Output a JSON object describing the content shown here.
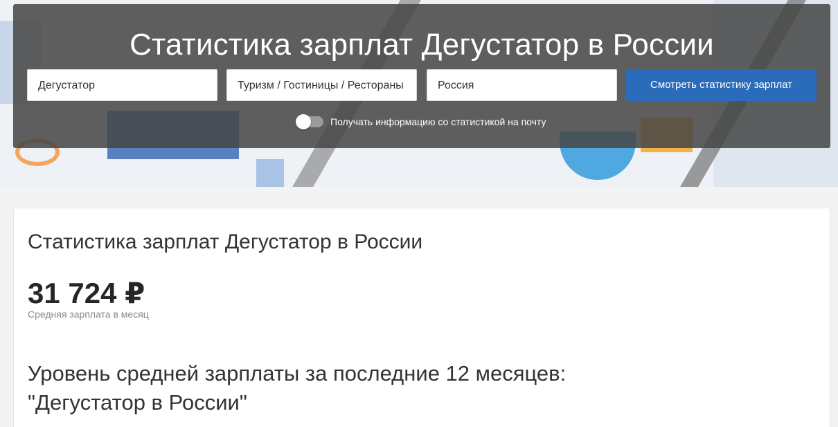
{
  "hero": {
    "title": "Статистика зарплат Дегустатор в России",
    "fields": {
      "profession": "Дегустатор",
      "industry": "Туризм / Гостиницы / Рестораны",
      "region": "Россия"
    },
    "search_button": "Смотреть статистику зарплат",
    "subscribe_label": "Получать информацию со статистикой на почту",
    "subscribe_enabled": false
  },
  "card": {
    "title": "Статистика зарплат Дегустатор в России",
    "salary_value": "31 724 ₽",
    "salary_caption": "Средняя зарплата в месяц",
    "section_title_line1": "Уровень средней зарплаты за последние 12 месяцев:",
    "section_title_line2": "\"Дегустатор в России\""
  },
  "colors": {
    "accent": "#2a6cba",
    "hero_overlay": "#464646"
  }
}
